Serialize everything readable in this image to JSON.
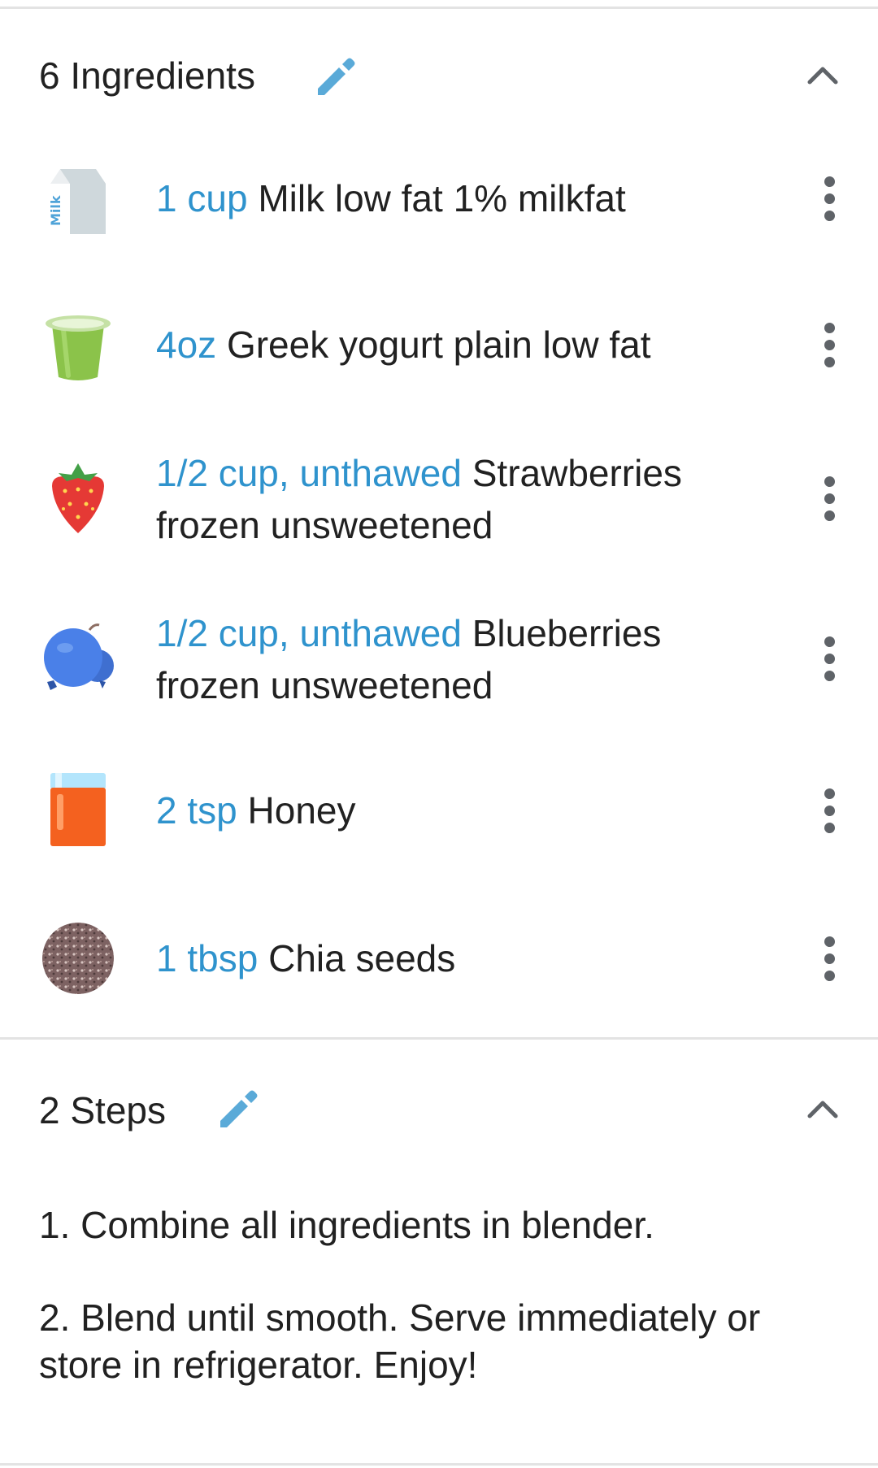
{
  "ingredients_section": {
    "title": "6 Ingredients",
    "items": [
      {
        "quantity": "1 cup",
        "name": "Milk low fat 1% milkfat",
        "icon": "milk-carton-icon"
      },
      {
        "quantity": "4oz",
        "name": "Greek yogurt plain low fat",
        "icon": "yogurt-cup-icon"
      },
      {
        "quantity": "1/2 cup, unthawed",
        "name": "Strawberries frozen unsweetened",
        "icon": "strawberry-icon"
      },
      {
        "quantity": "1/2 cup, unthawed",
        "name": "Blueberries frozen unsweetened",
        "icon": "blueberries-icon"
      },
      {
        "quantity": "2 tsp",
        "name": "Honey",
        "icon": "honey-jar-icon"
      },
      {
        "quantity": "1 tbsp",
        "name": "Chia seeds",
        "icon": "chia-seeds-icon"
      }
    ]
  },
  "steps_section": {
    "title": "2 Steps",
    "steps": [
      "1.  Combine all ingredients in blender.",
      "2.  Blend until smooth.  Serve immediately or store in refrigerator.  Enjoy!"
    ]
  },
  "colors": {
    "accent": "#2f93cd",
    "edit_icon": "#5aaad8",
    "text": "#212121",
    "divider": "#e3e3e3"
  }
}
